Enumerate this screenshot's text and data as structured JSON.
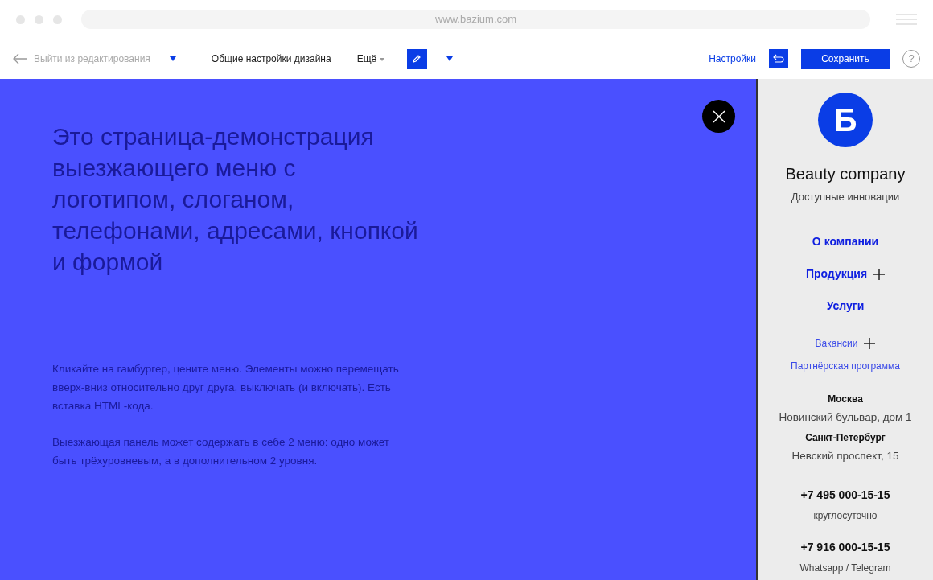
{
  "browser": {
    "url": "www.bazium.com"
  },
  "toolbar": {
    "exit": "Выйти из редактирования",
    "design": "Общие настройки дизайна",
    "more": "Ещё",
    "settings": "Настройки",
    "save": "Сохранить",
    "help": "?"
  },
  "content": {
    "heading": "Это страница-демонстрация выезжающего меню с логотипом, слоганом, телефонами, адресами, кнопкой и формой",
    "paragraphs": [
      "Кликайте на гамбургер, цените меню. Элементы можно перемещать вверх-вниз относительно друг друга, выключать (и включать). Есть вставка HTML-кода.",
      "Выезжающая панель может содержать в себе 2 меню: одно может быть трёхуровневым, а в дополнительном 2 уровня."
    ]
  },
  "panel": {
    "logo_letter": "Б",
    "company": "Beauty company",
    "slogan": "Доступные инновации",
    "menu": [
      {
        "label": "О компании",
        "kind": "main",
        "expandable": false
      },
      {
        "label": "Продукция",
        "kind": "main",
        "expandable": true
      },
      {
        "label": "Услуги",
        "kind": "main",
        "expandable": false
      },
      {
        "label": "Вакансии",
        "kind": "secondary",
        "expandable": true
      },
      {
        "label": "Партнёрская программа",
        "kind": "secondary",
        "expandable": false
      }
    ],
    "addresses": [
      {
        "city": "Москва",
        "address": "Новинский бульвар, дом 1"
      },
      {
        "city": "Санкт-Петербург",
        "address": "Невский проспект, 15"
      }
    ],
    "phones": [
      {
        "number": "+7 495 000-15-15",
        "note": "круглосуточно"
      },
      {
        "number": "+7 916 000-15-15",
        "note": "Whatsapp / Telegram"
      }
    ]
  }
}
